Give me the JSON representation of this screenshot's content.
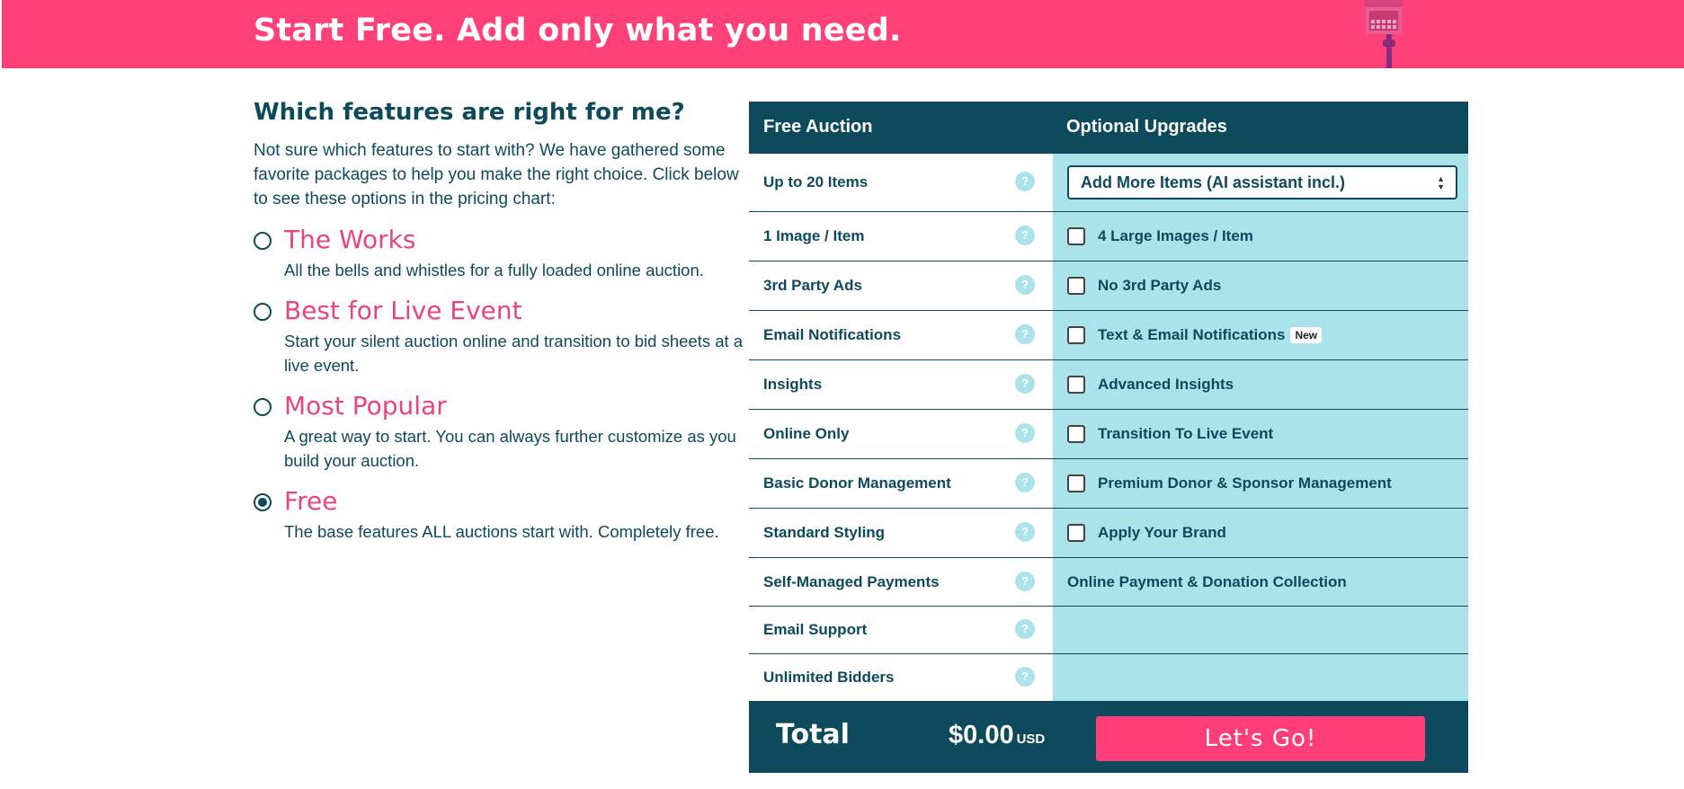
{
  "banner": {
    "title": "Start Free. Add only what you need."
  },
  "left": {
    "heading": "Which features are right for me?",
    "intro": "Not sure which features to start with? We have gathered some favorite packages to help you make the right choice. Click below to see these options in the pricing chart:",
    "packages": [
      {
        "name": "The Works",
        "desc": "All the bells and whistles for a fully loaded online auction.",
        "selected": false
      },
      {
        "name": "Best for Live Event",
        "desc": "Start your silent auction online and transition to bid sheets at a live event.",
        "selected": false
      },
      {
        "name": "Most Popular",
        "desc": "A great way to start. You can always further customize as you build your auction.",
        "selected": false
      },
      {
        "name": "Free",
        "desc": "The base features ALL auctions start with. Completely free.",
        "selected": true
      }
    ]
  },
  "table": {
    "header": {
      "free": "Free Auction",
      "upgrades": "Optional Upgrades"
    },
    "help_glyph": "?",
    "rows": [
      {
        "free": "Up to 20 Items",
        "upgrade": "Add More Items (AI assistant incl.)"
      },
      {
        "free": "1 Image / Item",
        "upgrade": "4 Large Images / Item"
      },
      {
        "free": "3rd Party Ads",
        "upgrade": "No 3rd Party Ads"
      },
      {
        "free": "Email Notifications",
        "upgrade": "Text & Email Notifications",
        "badge": "New"
      },
      {
        "free": "Insights",
        "upgrade": "Advanced Insights"
      },
      {
        "free": "Online Only",
        "upgrade": "Transition To Live Event"
      },
      {
        "free": "Basic Donor Management",
        "upgrade": "Premium Donor & Sponsor Management"
      },
      {
        "free": "Standard Styling",
        "upgrade": "Apply Your Brand"
      },
      {
        "free": "Self-Managed Payments",
        "upgrade": "Online Payment & Donation Collection"
      },
      {
        "free": "Email Support",
        "upgrade": ""
      },
      {
        "free": "Unlimited Bidders",
        "upgrade": ""
      }
    ],
    "footer": {
      "total_label": "Total",
      "amount": "$0.00",
      "currency": "USD",
      "cta": "Let's Go!"
    }
  },
  "colors": {
    "pink": "#ff4079",
    "navy": "#0d4a5c",
    "aqua": "#abe3ea"
  }
}
